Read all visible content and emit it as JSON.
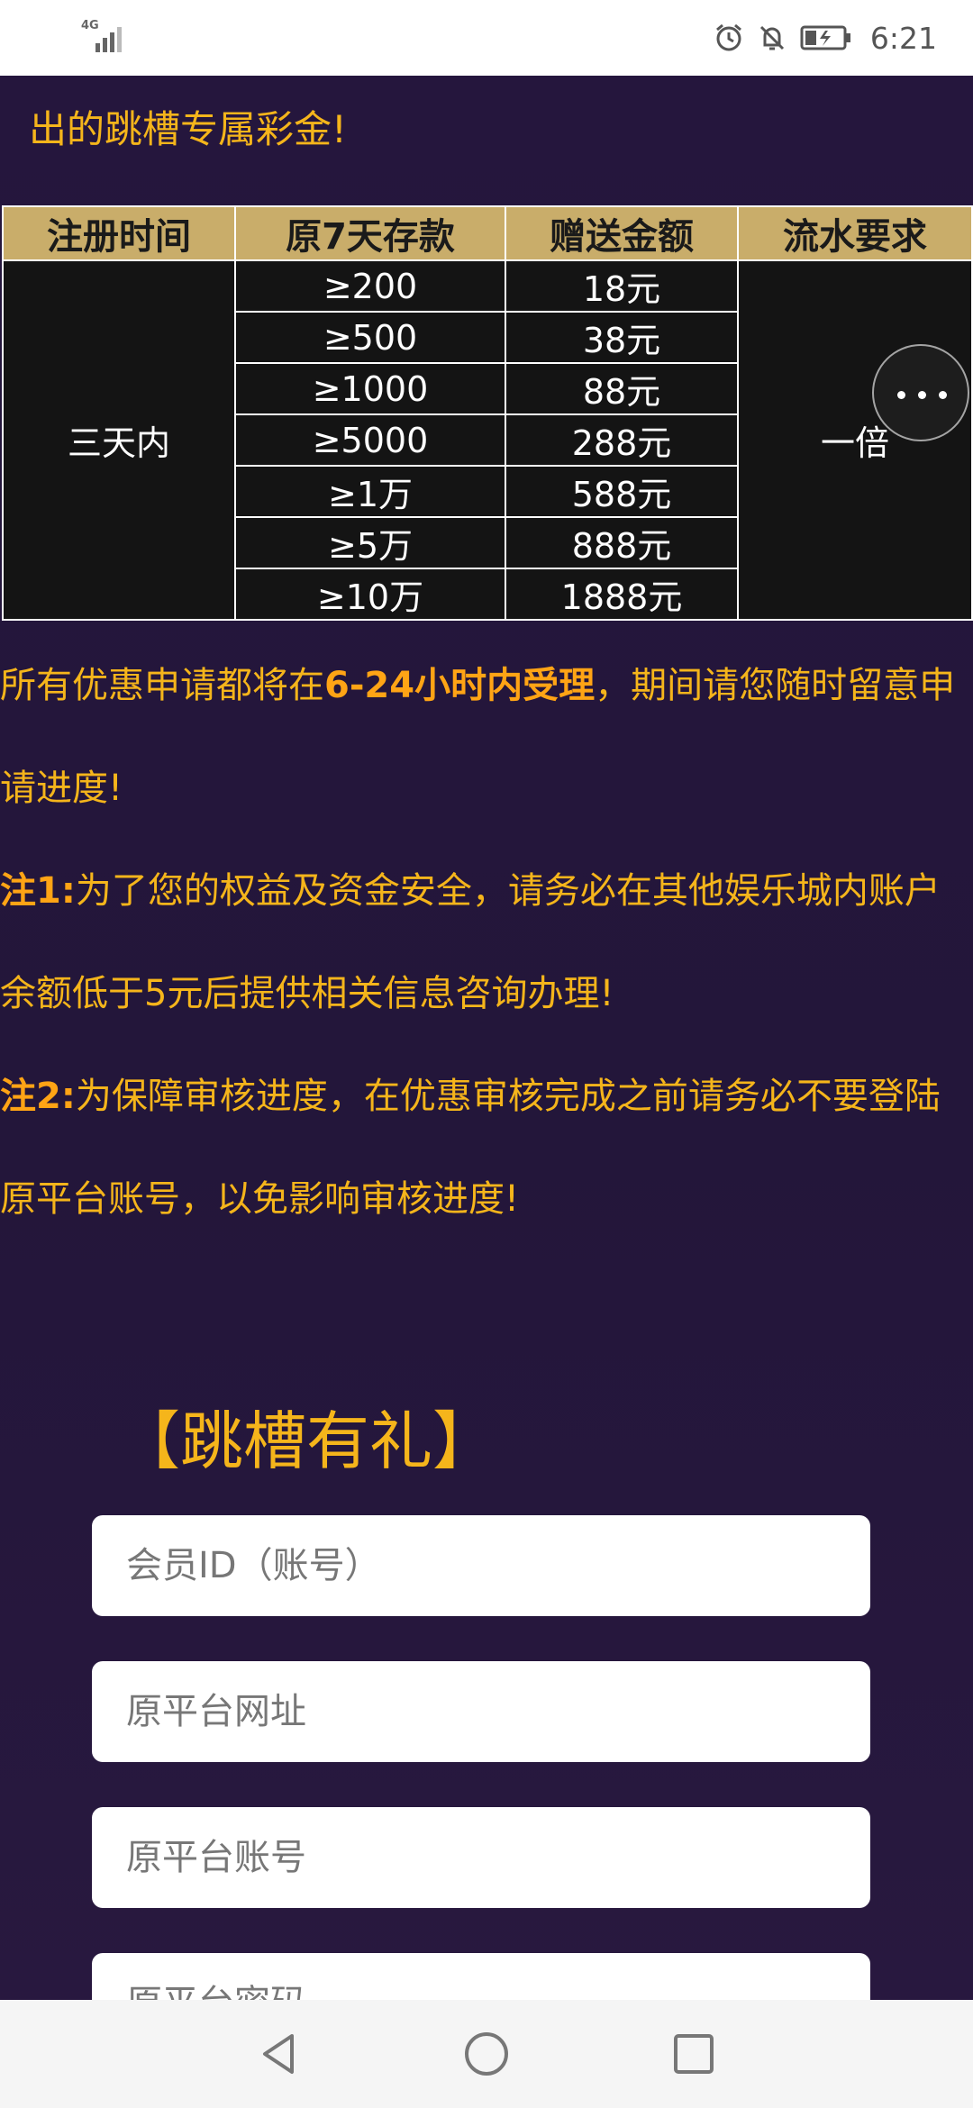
{
  "status_bar": {
    "network": "4G",
    "time": "6:21"
  },
  "intro_text": "出的跳槽专属彩金!",
  "promo_table": {
    "headers": [
      "注册时间",
      "原7天存款",
      "赠送金额",
      "流水要求"
    ],
    "registration_period": "三天内",
    "wagering": "一倍",
    "rows": [
      {
        "deposit": "≥200",
        "bonus": "18元"
      },
      {
        "deposit": "≥500",
        "bonus": "38元"
      },
      {
        "deposit": "≥1000",
        "bonus": "88元"
      },
      {
        "deposit": "≥5000",
        "bonus": "288元"
      },
      {
        "deposit": "≥1万",
        "bonus": "588元"
      },
      {
        "deposit": "≥5万",
        "bonus": "888元"
      },
      {
        "deposit": "≥10万",
        "bonus": "1888元"
      }
    ]
  },
  "notice": {
    "p1_before": "所有优惠申请都将在",
    "p1_highlight": "6-24小时内受理",
    "p1_after": "，期间请您随时留意申请进度!",
    "note1_label": "注1:",
    "note1_text": "为了您的权益及资金安全，请务必在其他娱乐城内账户余额低于5元后提供相关信息咨询办理!",
    "note2_label": "注2:",
    "note2_text": "为保障审核进度，在优惠审核完成之前请务必不要登陆原平台账号，以免影响审核进度!"
  },
  "form": {
    "title": "【跳槽有礼】",
    "member_id_placeholder": "会员ID（账号）",
    "platform_url_placeholder": "原平台网址",
    "platform_account_placeholder": "原平台账号",
    "platform_password_placeholder": "原平台密码"
  },
  "colors": {
    "background": "#24163a",
    "accent": "#f5b51b",
    "table_header": "#c9ad6a"
  }
}
